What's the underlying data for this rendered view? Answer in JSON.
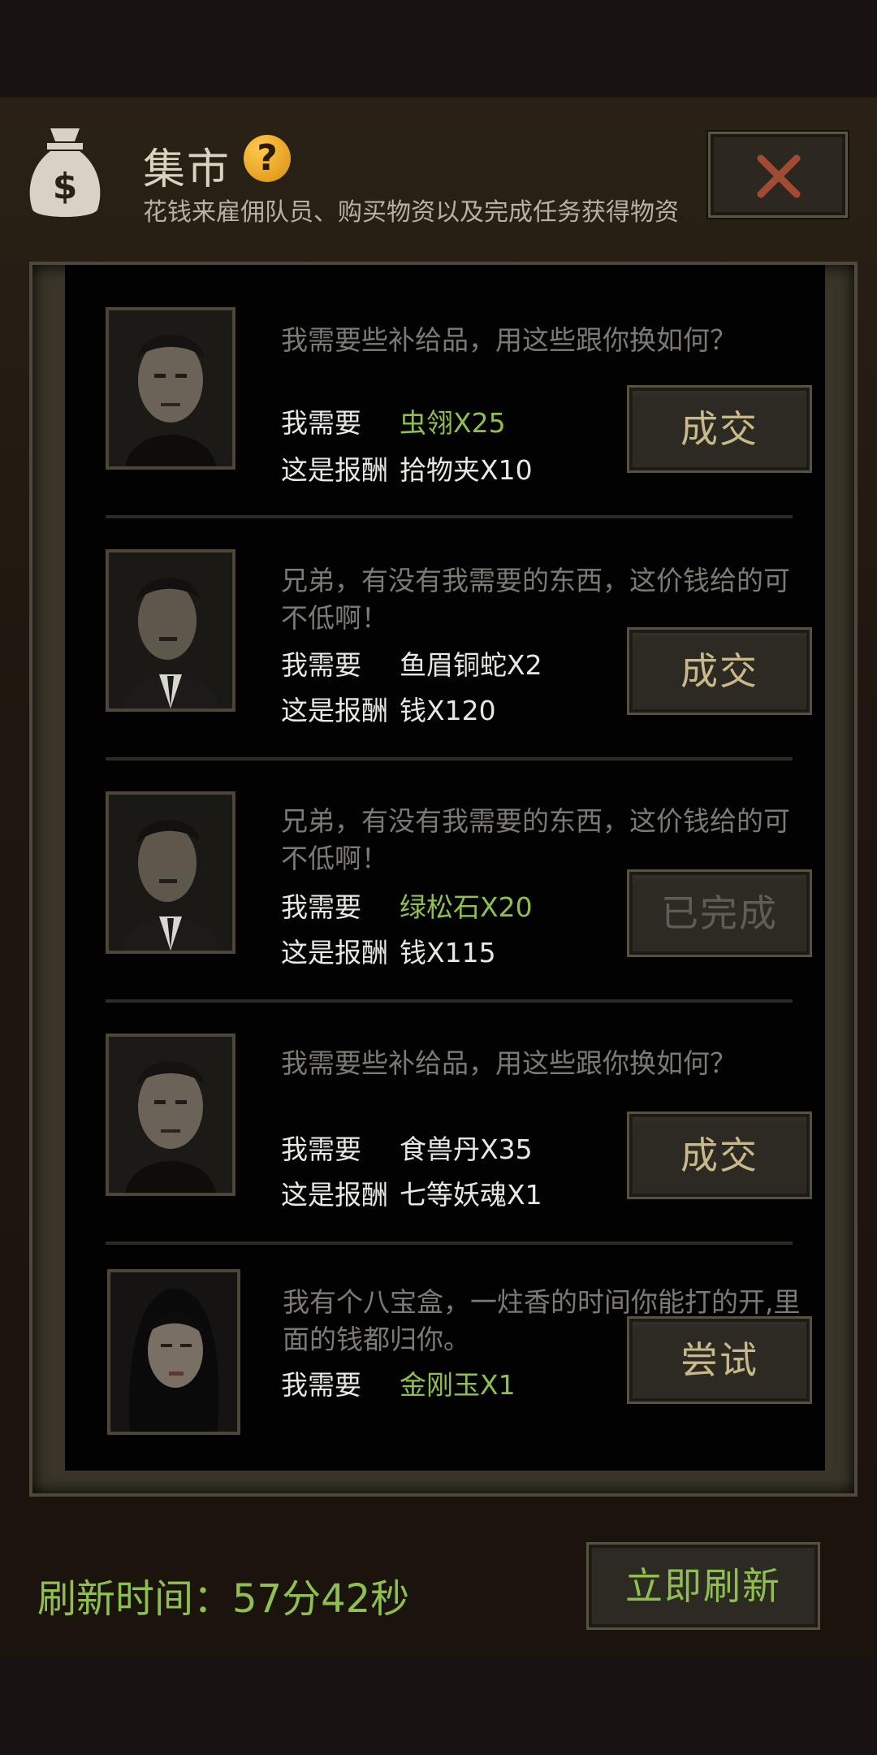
{
  "header": {
    "title": "集市",
    "help_glyph": "?",
    "subtitle": "花钱来雇佣队员、购买物资以及完成任务获得物资",
    "bag_icon": "money-bag-icon",
    "close_icon": "close-icon"
  },
  "offers": [
    {
      "message": "我需要些补给品，用这些跟你换如何？",
      "need_label": "我需要",
      "need_value": "虫翎X25",
      "reward_label": "这是报酬",
      "reward_value": "拾物夹X10",
      "button": "成交"
    },
    {
      "message": "兄弟，有没有我需要的东西，这价钱给的可不低啊！",
      "need_label": "我需要",
      "need_value": "鱼眉铜蛇X2",
      "reward_label": "这是报酬",
      "reward_value": "钱X120",
      "button": "成交"
    },
    {
      "message": "兄弟，有没有我需要的东西，这价钱给的可不低啊！",
      "need_label": "我需要",
      "need_value": "绿松石X20",
      "reward_label": "这是报酬",
      "reward_value": "钱X115",
      "button": "已完成"
    },
    {
      "message": "我需要些补给品，用这些跟你换如何？",
      "need_label": "我需要",
      "need_value": "食兽丹X35",
      "reward_label": "这是报酬",
      "reward_value": "七等妖魂X1",
      "button": "成交"
    },
    {
      "message": "我有个八宝盒，一炷香的时间你能打的开,里面的钱都归你。",
      "need_label": "我需要",
      "need_value": "金刚玉X1",
      "button": "尝试"
    }
  ],
  "footer": {
    "refresh_label": "刷新时间：57分42秒",
    "refresh_button": "立即刷新"
  },
  "colors": {
    "accent_green": "#8fc04d",
    "button_text": "#c8b98a",
    "help_badge": "#f0a526"
  }
}
